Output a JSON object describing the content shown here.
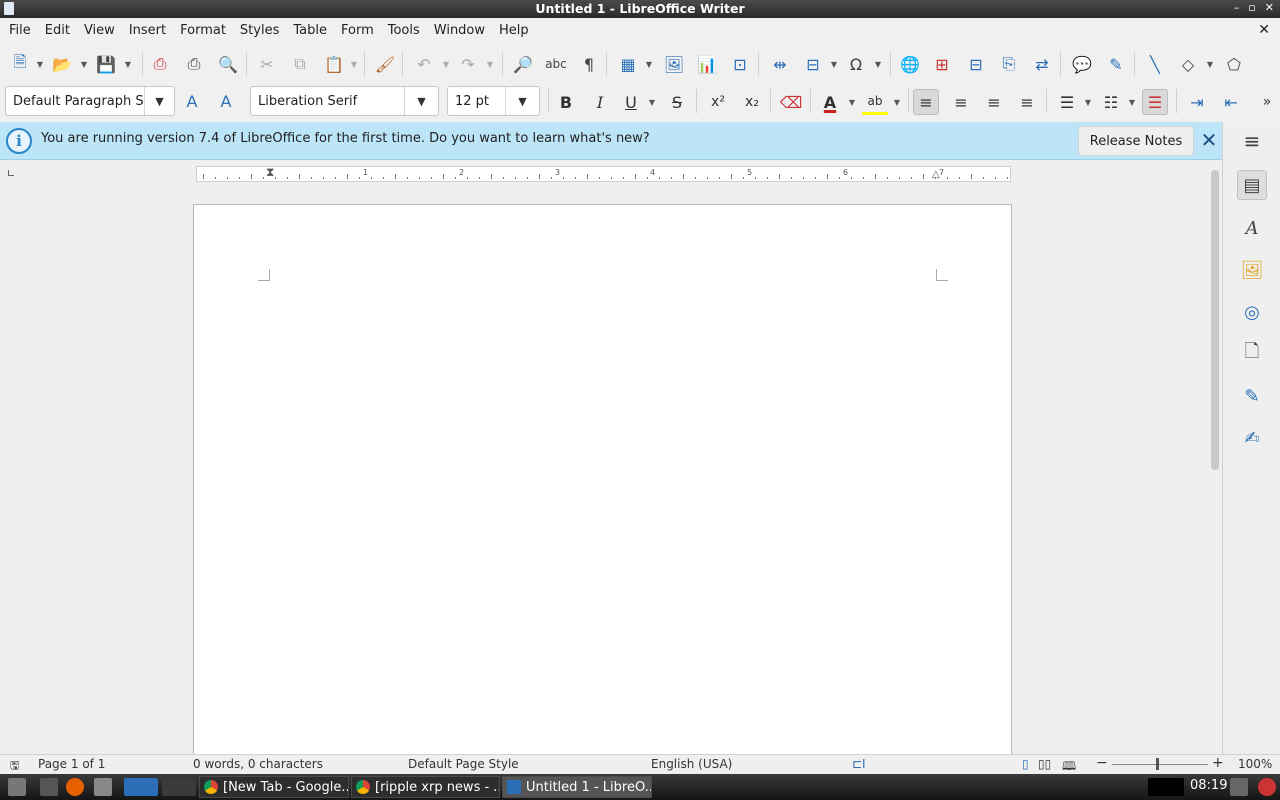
{
  "window": {
    "title": "Untitled 1 - LibreOffice Writer"
  },
  "menu": [
    "File",
    "Edit",
    "View",
    "Insert",
    "Format",
    "Styles",
    "Table",
    "Form",
    "Tools",
    "Window",
    "Help"
  ],
  "formatting": {
    "paragraph_style": "Default Paragraph S",
    "font_name": "Liberation Serif",
    "font_size": "12 pt",
    "bold": "B",
    "italic": "I",
    "underline": "U",
    "strikethrough": "S"
  },
  "infobar": {
    "message": "You are running version 7.4 of LibreOffice for the first time. Do you want to learn what's new?",
    "button": "Release Notes"
  },
  "ruler_numbers": [
    "1",
    "2",
    "3",
    "4",
    "5",
    "6",
    "7"
  ],
  "status": {
    "page": "Page 1 of 1",
    "words": "0 words, 0 characters",
    "page_style": "Default Page Style",
    "language": "English (USA)",
    "zoom": "100%"
  },
  "taskbar": {
    "tasks": [
      "[New Tab - Google...",
      "[ripple xrp news - ...",
      "Untitled 1 - LibreO..."
    ],
    "clock": "08:19"
  },
  "colors": {
    "font_color": "#c9211e",
    "highlight_color": "#ffff00",
    "infobar_bg": "#bde5f8"
  }
}
